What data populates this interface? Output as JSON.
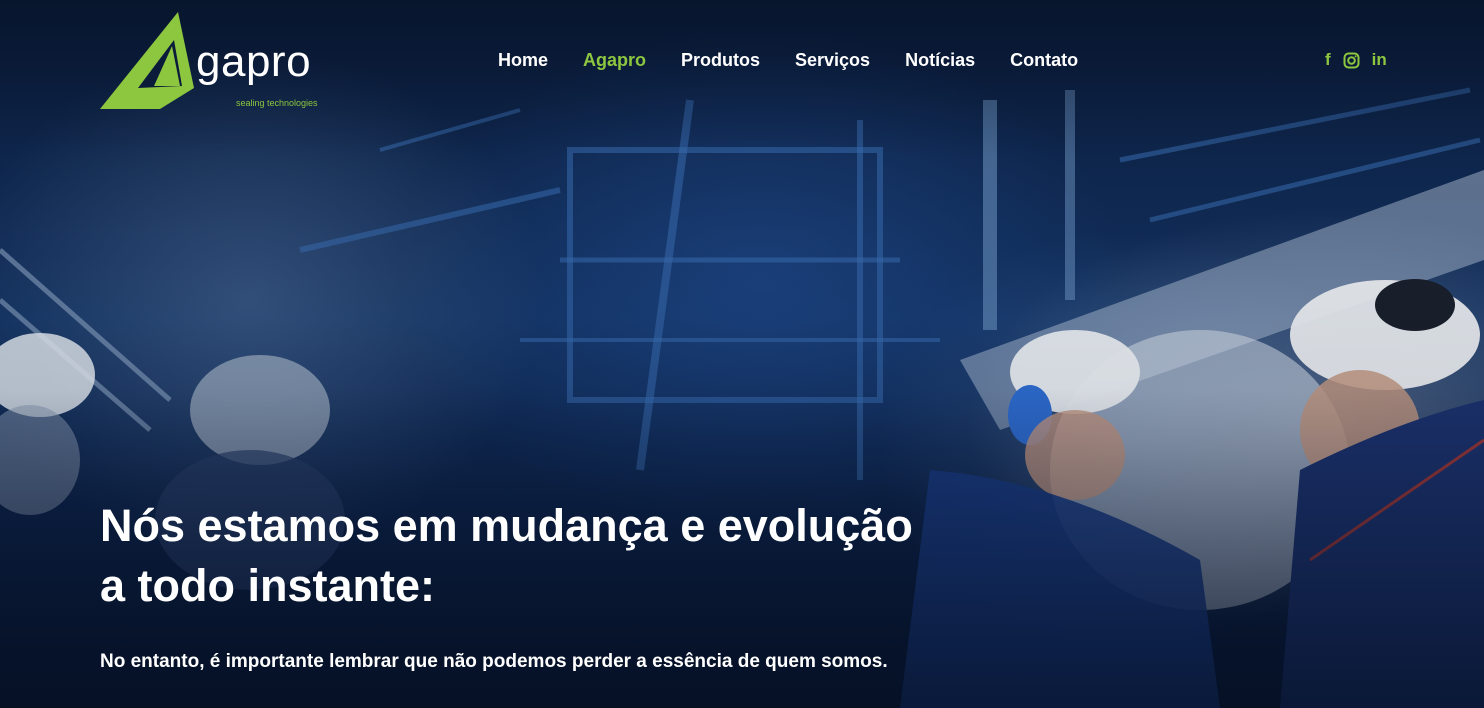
{
  "brand": {
    "name": "gapro",
    "tagline": "sealing technologies",
    "accent_color": "#8dc63f",
    "logo_mark": "green-triangle-a-mark"
  },
  "nav": {
    "items": [
      {
        "label": "Home",
        "active": false
      },
      {
        "label": "Agapro",
        "active": true
      },
      {
        "label": "Produtos",
        "active": false
      },
      {
        "label": "Serviços",
        "active": false
      },
      {
        "label": "Notícias",
        "active": false
      },
      {
        "label": "Contato",
        "active": false
      }
    ]
  },
  "social": {
    "facebook": "f",
    "instagram_icon": "instagram-icon",
    "linkedin": "in"
  },
  "hero": {
    "headline_line1": "Nós estamos em mudança e evolução",
    "headline_line2": "a todo instante:",
    "subline": "No entanto, é importante lembrar que não podemos perder a essência de quem somos.",
    "background": "industrial-workers-with-hard-hats-photo"
  }
}
